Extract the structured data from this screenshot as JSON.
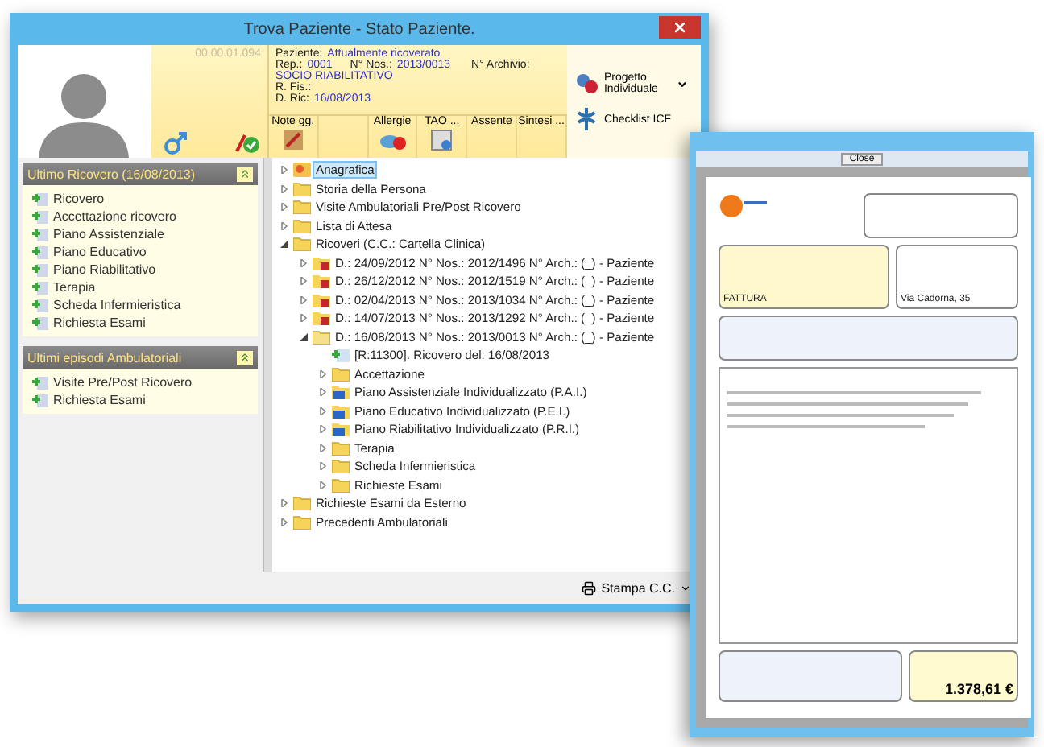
{
  "window": {
    "title": "Trova Paziente - Stato Paziente."
  },
  "header": {
    "code": "00.00.01.094",
    "info": [
      {
        "label": "Paziente:",
        "value": "Attualmente ricoverato"
      },
      {
        "label": "Rep.:",
        "value": "0001",
        "label2": "N° Nos.:",
        "value2": "2013/0013",
        "label3": "N° Archivio:"
      },
      {
        "value": "SOCIO RIABILITATIVO"
      },
      {
        "label": "R. Fis.:"
      },
      {
        "label": "D. Ric:",
        "value": "16/08/2013"
      }
    ],
    "tools": [
      {
        "label": "Note gg.",
        "kind": "notes"
      },
      {
        "kind": "none"
      },
      {
        "label": "Allergie",
        "kind": "allergy"
      },
      {
        "label": "TAO ...",
        "kind": "calendar"
      },
      {
        "label": "Assente",
        "kind": "none"
      },
      {
        "label": "Sintesi ...",
        "kind": "none"
      }
    ],
    "actions": [
      {
        "label": "Progetto Individuale",
        "kind": "project",
        "menu": true
      },
      {
        "label": "Checklist ICF",
        "kind": "checklist",
        "menu": false
      }
    ]
  },
  "sections": [
    {
      "title": "Ultimo Ricovero (16/08/2013)",
      "expanded": true,
      "items": [
        "Ricovero",
        "Accettazione ricovero",
        "Piano Assistenziale",
        "Piano Educativo",
        "Piano Riabilitativo",
        "Terapia",
        "Scheda Infermieristica",
        "Richiesta Esami"
      ]
    },
    {
      "title": "Ultimi episodi Ambulatoriali",
      "expanded": true,
      "items": [
        "Visite Pre/Post Ricovero",
        "Richiesta Esami"
      ]
    }
  ],
  "tree": [
    {
      "label": "Anagrafica",
      "kind": "person",
      "selected": true,
      "expanded": false
    },
    {
      "label": "Storia della Persona",
      "kind": "folder",
      "selected": false,
      "expanded": false
    },
    {
      "label": "Visite Ambulatoriali Pre/Post Ricovero",
      "kind": "folder",
      "selected": false,
      "expanded": false
    },
    {
      "label": "Lista di Attesa",
      "kind": "folder",
      "selected": false,
      "expanded": false
    },
    {
      "label": "Ricoveri (C.C.: Cartella Clinica)",
      "kind": "folder",
      "selected": false,
      "expanded": true,
      "children": [
        {
          "label": "D.: 24/09/2012 N° Nos.: 2012/1496 N° Arch.:  (_) - Paziente",
          "kind": "locked",
          "selected": false,
          "expanded": false
        },
        {
          "label": "D.: 26/12/2012 N° Nos.: 2012/1519 N° Arch.:  (_) - Paziente",
          "kind": "locked",
          "selected": false,
          "expanded": false
        },
        {
          "label": "D.: 02/04/2013 N° Nos.: 2013/1034 N° Arch.:  (_) - Paziente",
          "kind": "locked",
          "selected": false,
          "expanded": false
        },
        {
          "label": "D.: 14/07/2013 N° Nos.: 2013/1292 N° Arch.:  (_) - Paziente",
          "kind": "locked",
          "selected": false,
          "expanded": false
        },
        {
          "label": "D.: 16/08/2013 N° Nos.: 2013/0013 N° Arch.:  (_) - Paziente",
          "kind": "open",
          "selected": false,
          "expanded": true,
          "children": [
            {
              "label": "[R:11300]. Ricovero del:  16/08/2013",
              "kind": "entry",
              "selected": false
            },
            {
              "label": "Accettazione",
              "kind": "folder",
              "selected": false,
              "expanded": false
            },
            {
              "label": "Piano Assistenziale Individualizzato (P.A.I.)",
              "kind": "plan",
              "selected": false,
              "expanded": false
            },
            {
              "label": "Piano Educativo Individualizzato (P.E.I.)",
              "kind": "plan",
              "selected": false,
              "expanded": false
            },
            {
              "label": "Piano Riabilitativo Individualizzato (P.R.I.)",
              "kind": "plan",
              "selected": false,
              "expanded": false
            },
            {
              "label": "Terapia",
              "kind": "folder",
              "selected": false,
              "expanded": false
            },
            {
              "label": "Scheda Infermieristica",
              "kind": "folder",
              "selected": false,
              "expanded": false
            },
            {
              "label": "Richieste Esami",
              "kind": "folder",
              "selected": false,
              "expanded": false
            }
          ]
        }
      ]
    },
    {
      "label": "Richieste Esami da Esterno",
      "kind": "folder",
      "selected": false,
      "expanded": false
    },
    {
      "label": "Precedenti Ambulatoriali",
      "kind": "folder",
      "selected": false,
      "expanded": false
    }
  ],
  "footer": {
    "print_button": "Stampa C.C."
  },
  "preview": {
    "close_button": "Close",
    "doc_type": "FATTURA",
    "address": "Via Cadorna, 35",
    "total": "1.378,61 €"
  }
}
